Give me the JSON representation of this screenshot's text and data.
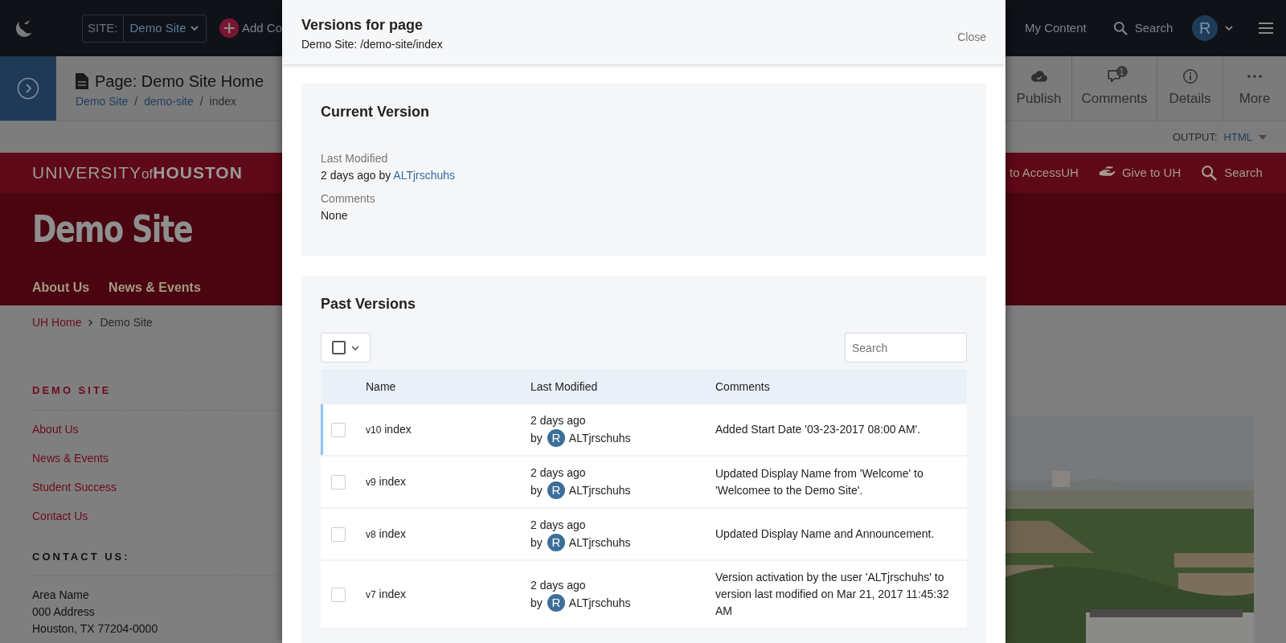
{
  "top_bar": {
    "site_label": "SITE:",
    "site": "Demo Site",
    "add_label": "Add Co",
    "my_content": "My Content",
    "search": "Search",
    "avatar": "R"
  },
  "page_bar": {
    "title": "Page: Demo Site Home",
    "separator": "/",
    "breadcrumbs": [
      {
        "label": "Demo Site",
        "link": true
      },
      {
        "label": "demo-site",
        "link": true
      },
      {
        "label": "index",
        "link": false
      }
    ],
    "actions": [
      {
        "label": "Publish"
      },
      {
        "label": "Comments",
        "badge": "1"
      },
      {
        "label": "Details"
      },
      {
        "label": "More"
      }
    ]
  },
  "output": {
    "label": "OUTPUT:",
    "value": "HTML"
  },
  "site": {
    "brand": [
      "UNIVERSITY",
      "of",
      "HOUSTON"
    ],
    "utility_links": [
      {
        "label": "to AccessUH"
      },
      {
        "label": "Give to UH"
      },
      {
        "label": "Search"
      }
    ],
    "title": "Demo Site",
    "nav": [
      "About Us",
      "News & Events"
    ],
    "breadcrumb": [
      {
        "label": "UH Home",
        "link": true
      },
      {
        "label": "Demo Site",
        "link": false
      }
    ],
    "sidebar_heading": "DEMO SITE",
    "sidebar_links": [
      "About Us",
      "News & Events",
      "Student Success",
      "Contact Us"
    ],
    "contact_heading": "CONTACT US:",
    "address": [
      "Area Name",
      "000 Address",
      "Houston, TX 77204-0000"
    ],
    "photo": {
      "kind": "picture"
    }
  },
  "modal": {
    "title": "Versions for page",
    "subtitle": "Demo Site: /demo-site/index",
    "close": "Close",
    "current_version": {
      "heading": "Current Version",
      "last_modified_label": "Last Modified",
      "last_modified": "2 days ago by",
      "user": "ALTjrschuhs",
      "comments_label": "Comments",
      "comments": "None"
    },
    "past_versions": {
      "heading": "Past Versions",
      "select_all_checked": false,
      "search_placeholder": "Search",
      "columns": [
        "Name",
        "Last Modified",
        "Comments"
      ],
      "rows": [
        {
          "version": "v10",
          "name": "index",
          "modified": "2 days ago",
          "by": "by",
          "avatar": "R",
          "user": "ALTjrschuhs",
          "comment": "Added Start Date '03-23-2017 08:00 AM'.",
          "checked": false,
          "focused": true
        },
        {
          "version": "v9",
          "name": "index",
          "modified": "2 days ago",
          "by": "by",
          "avatar": "R",
          "user": "ALTjrschuhs",
          "comment": "Updated Display Name from 'Welcome' to 'Welcomee to the Demo Site'.",
          "checked": false,
          "focused": false
        },
        {
          "version": "v8",
          "name": "index",
          "modified": "2 days ago",
          "by": "by",
          "avatar": "R",
          "user": "ALTjrschuhs",
          "comment": "Updated Display Name and Announcement.",
          "checked": false,
          "focused": false
        },
        {
          "version": "v7",
          "name": "index",
          "modified": "2 days ago",
          "by": "by",
          "avatar": "R",
          "user": "ALTjrschuhs",
          "comment": "Version activation by the user 'ALTjrschuhs' to version last modified on Mar 21, 2017 11:45:32 AM",
          "checked": false,
          "focused": false
        }
      ]
    }
  }
}
